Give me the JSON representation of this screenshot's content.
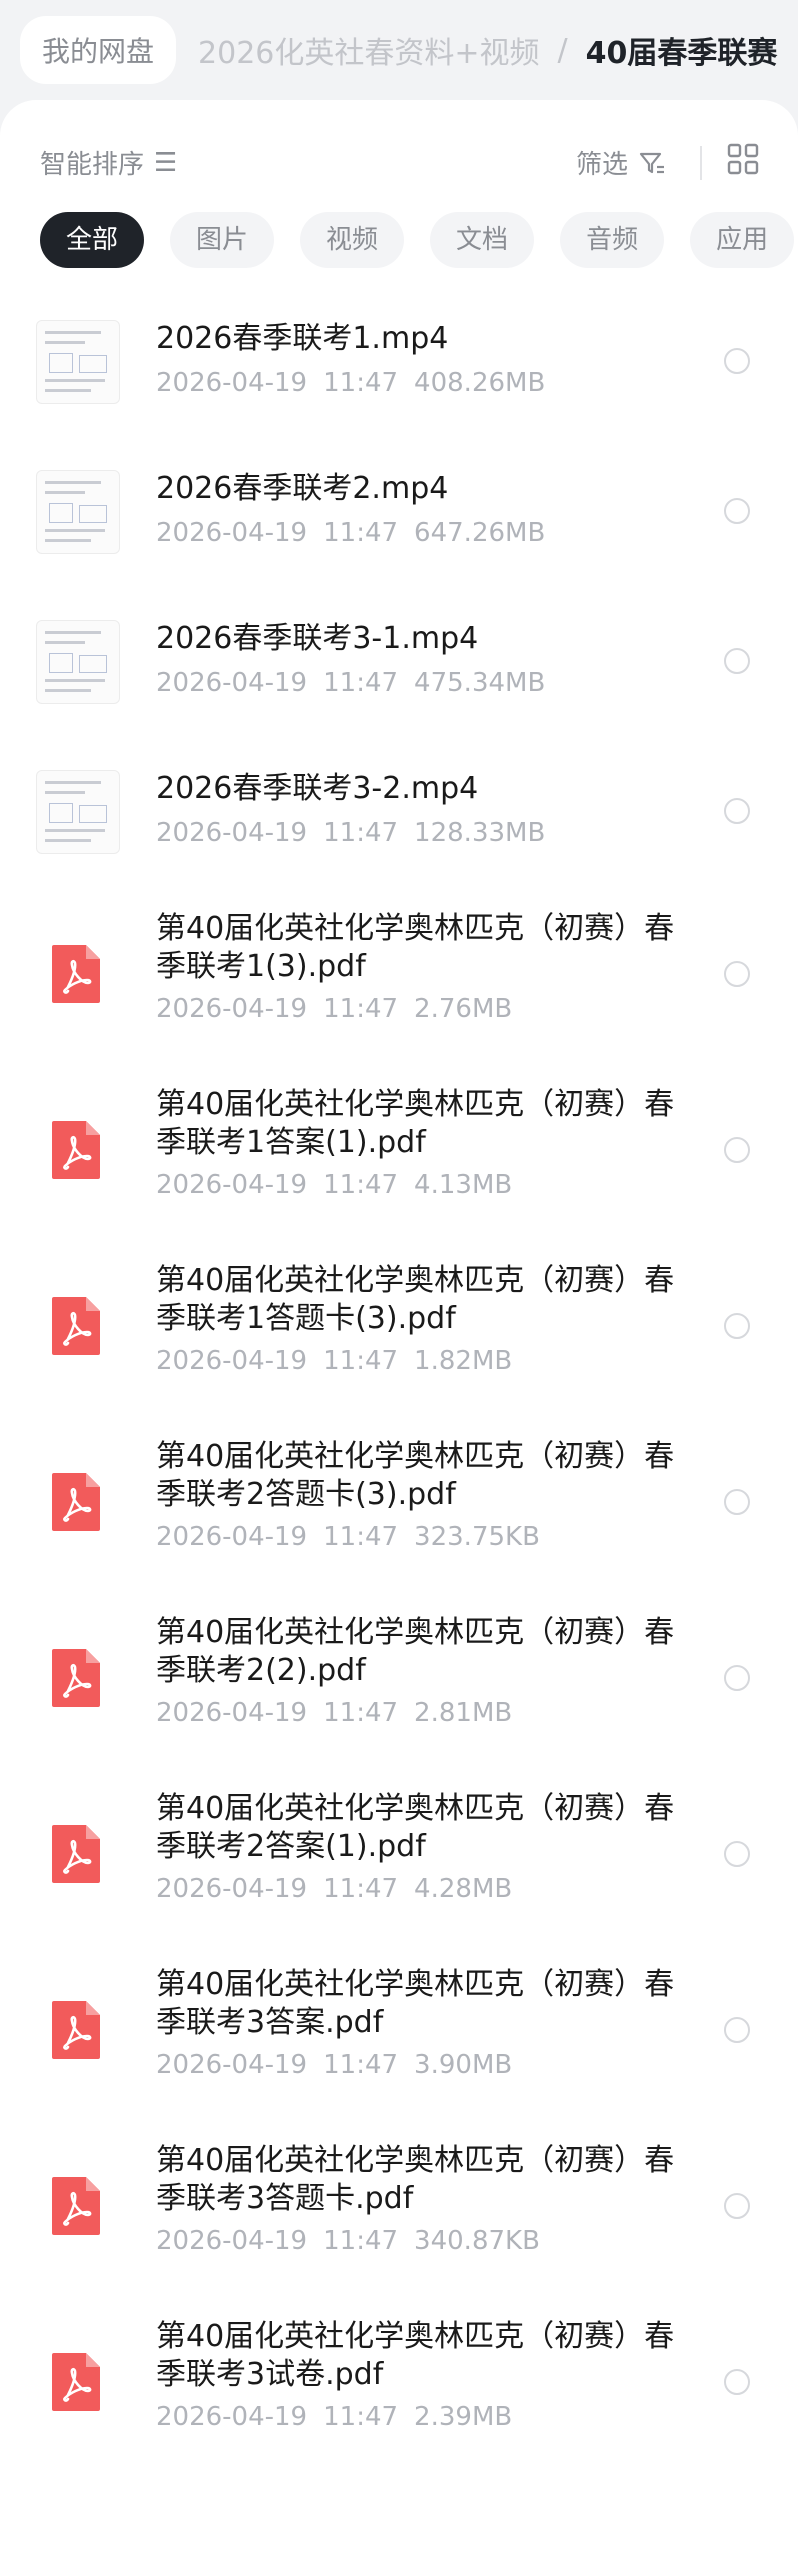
{
  "breadcrumb": {
    "home": "我的网盘",
    "parent": "2026化英社春资料+视频",
    "separator": "/",
    "current": "40届春季联赛"
  },
  "toolbar": {
    "sort_label": "智能排序",
    "sort_icon": "sort-lines-icon",
    "filter_label": "筛选",
    "filter_icon": "filter-icon",
    "view_icon": "grid-view-icon"
  },
  "tabs": [
    "全部",
    "图片",
    "视频",
    "文档",
    "音频",
    "应用"
  ],
  "colors": {
    "pdf_red": "#f25b5b",
    "active_tab": "#1f2329"
  },
  "files": [
    {
      "name": "2026春季联考1.mp4",
      "date": "2026-04-19",
      "time": "11:47",
      "size": "408.26MB",
      "type": "video"
    },
    {
      "name": "2026春季联考2.mp4",
      "date": "2026-04-19",
      "time": "11:47",
      "size": "647.26MB",
      "type": "video"
    },
    {
      "name": "2026春季联考3-1.mp4",
      "date": "2026-04-19",
      "time": "11:47",
      "size": "475.34MB",
      "type": "video"
    },
    {
      "name": "2026春季联考3-2.mp4",
      "date": "2026-04-19",
      "time": "11:47",
      "size": "128.33MB",
      "type": "video"
    },
    {
      "name": "第40届化英社化学奥林匹克（初赛）春季联考1(3).pdf",
      "date": "2026-04-19",
      "time": "11:47",
      "size": "2.76MB",
      "type": "pdf"
    },
    {
      "name": "第40届化英社化学奥林匹克（初赛）春季联考1答案(1).pdf",
      "date": "2026-04-19",
      "time": "11:47",
      "size": "4.13MB",
      "type": "pdf"
    },
    {
      "name": "第40届化英社化学奥林匹克（初赛）春季联考1答题卡(3).pdf",
      "date": "2026-04-19",
      "time": "11:47",
      "size": "1.82MB",
      "type": "pdf"
    },
    {
      "name": "第40届化英社化学奥林匹克（初赛）春季联考2答题卡(3).pdf",
      "date": "2026-04-19",
      "time": "11:47",
      "size": "323.75KB",
      "type": "pdf"
    },
    {
      "name": "第40届化英社化学奥林匹克（初赛）春季联考2(2).pdf",
      "date": "2026-04-19",
      "time": "11:47",
      "size": "2.81MB",
      "type": "pdf"
    },
    {
      "name": "第40届化英社化学奥林匹克（初赛）春季联考2答案(1).pdf",
      "date": "2026-04-19",
      "time": "11:47",
      "size": "4.28MB",
      "type": "pdf"
    },
    {
      "name": "第40届化英社化学奥林匹克（初赛）春季联考3答案.pdf",
      "date": "2026-04-19",
      "time": "11:47",
      "size": "3.90MB",
      "type": "pdf"
    },
    {
      "name": "第40届化英社化学奥林匹克（初赛）春季联考3答题卡.pdf",
      "date": "2026-04-19",
      "time": "11:47",
      "size": "340.87KB",
      "type": "pdf"
    },
    {
      "name": "第40届化英社化学奥林匹克（初赛）春季联考3试卷.pdf",
      "date": "2026-04-19",
      "time": "11:47",
      "size": "2.39MB",
      "type": "pdf"
    }
  ]
}
